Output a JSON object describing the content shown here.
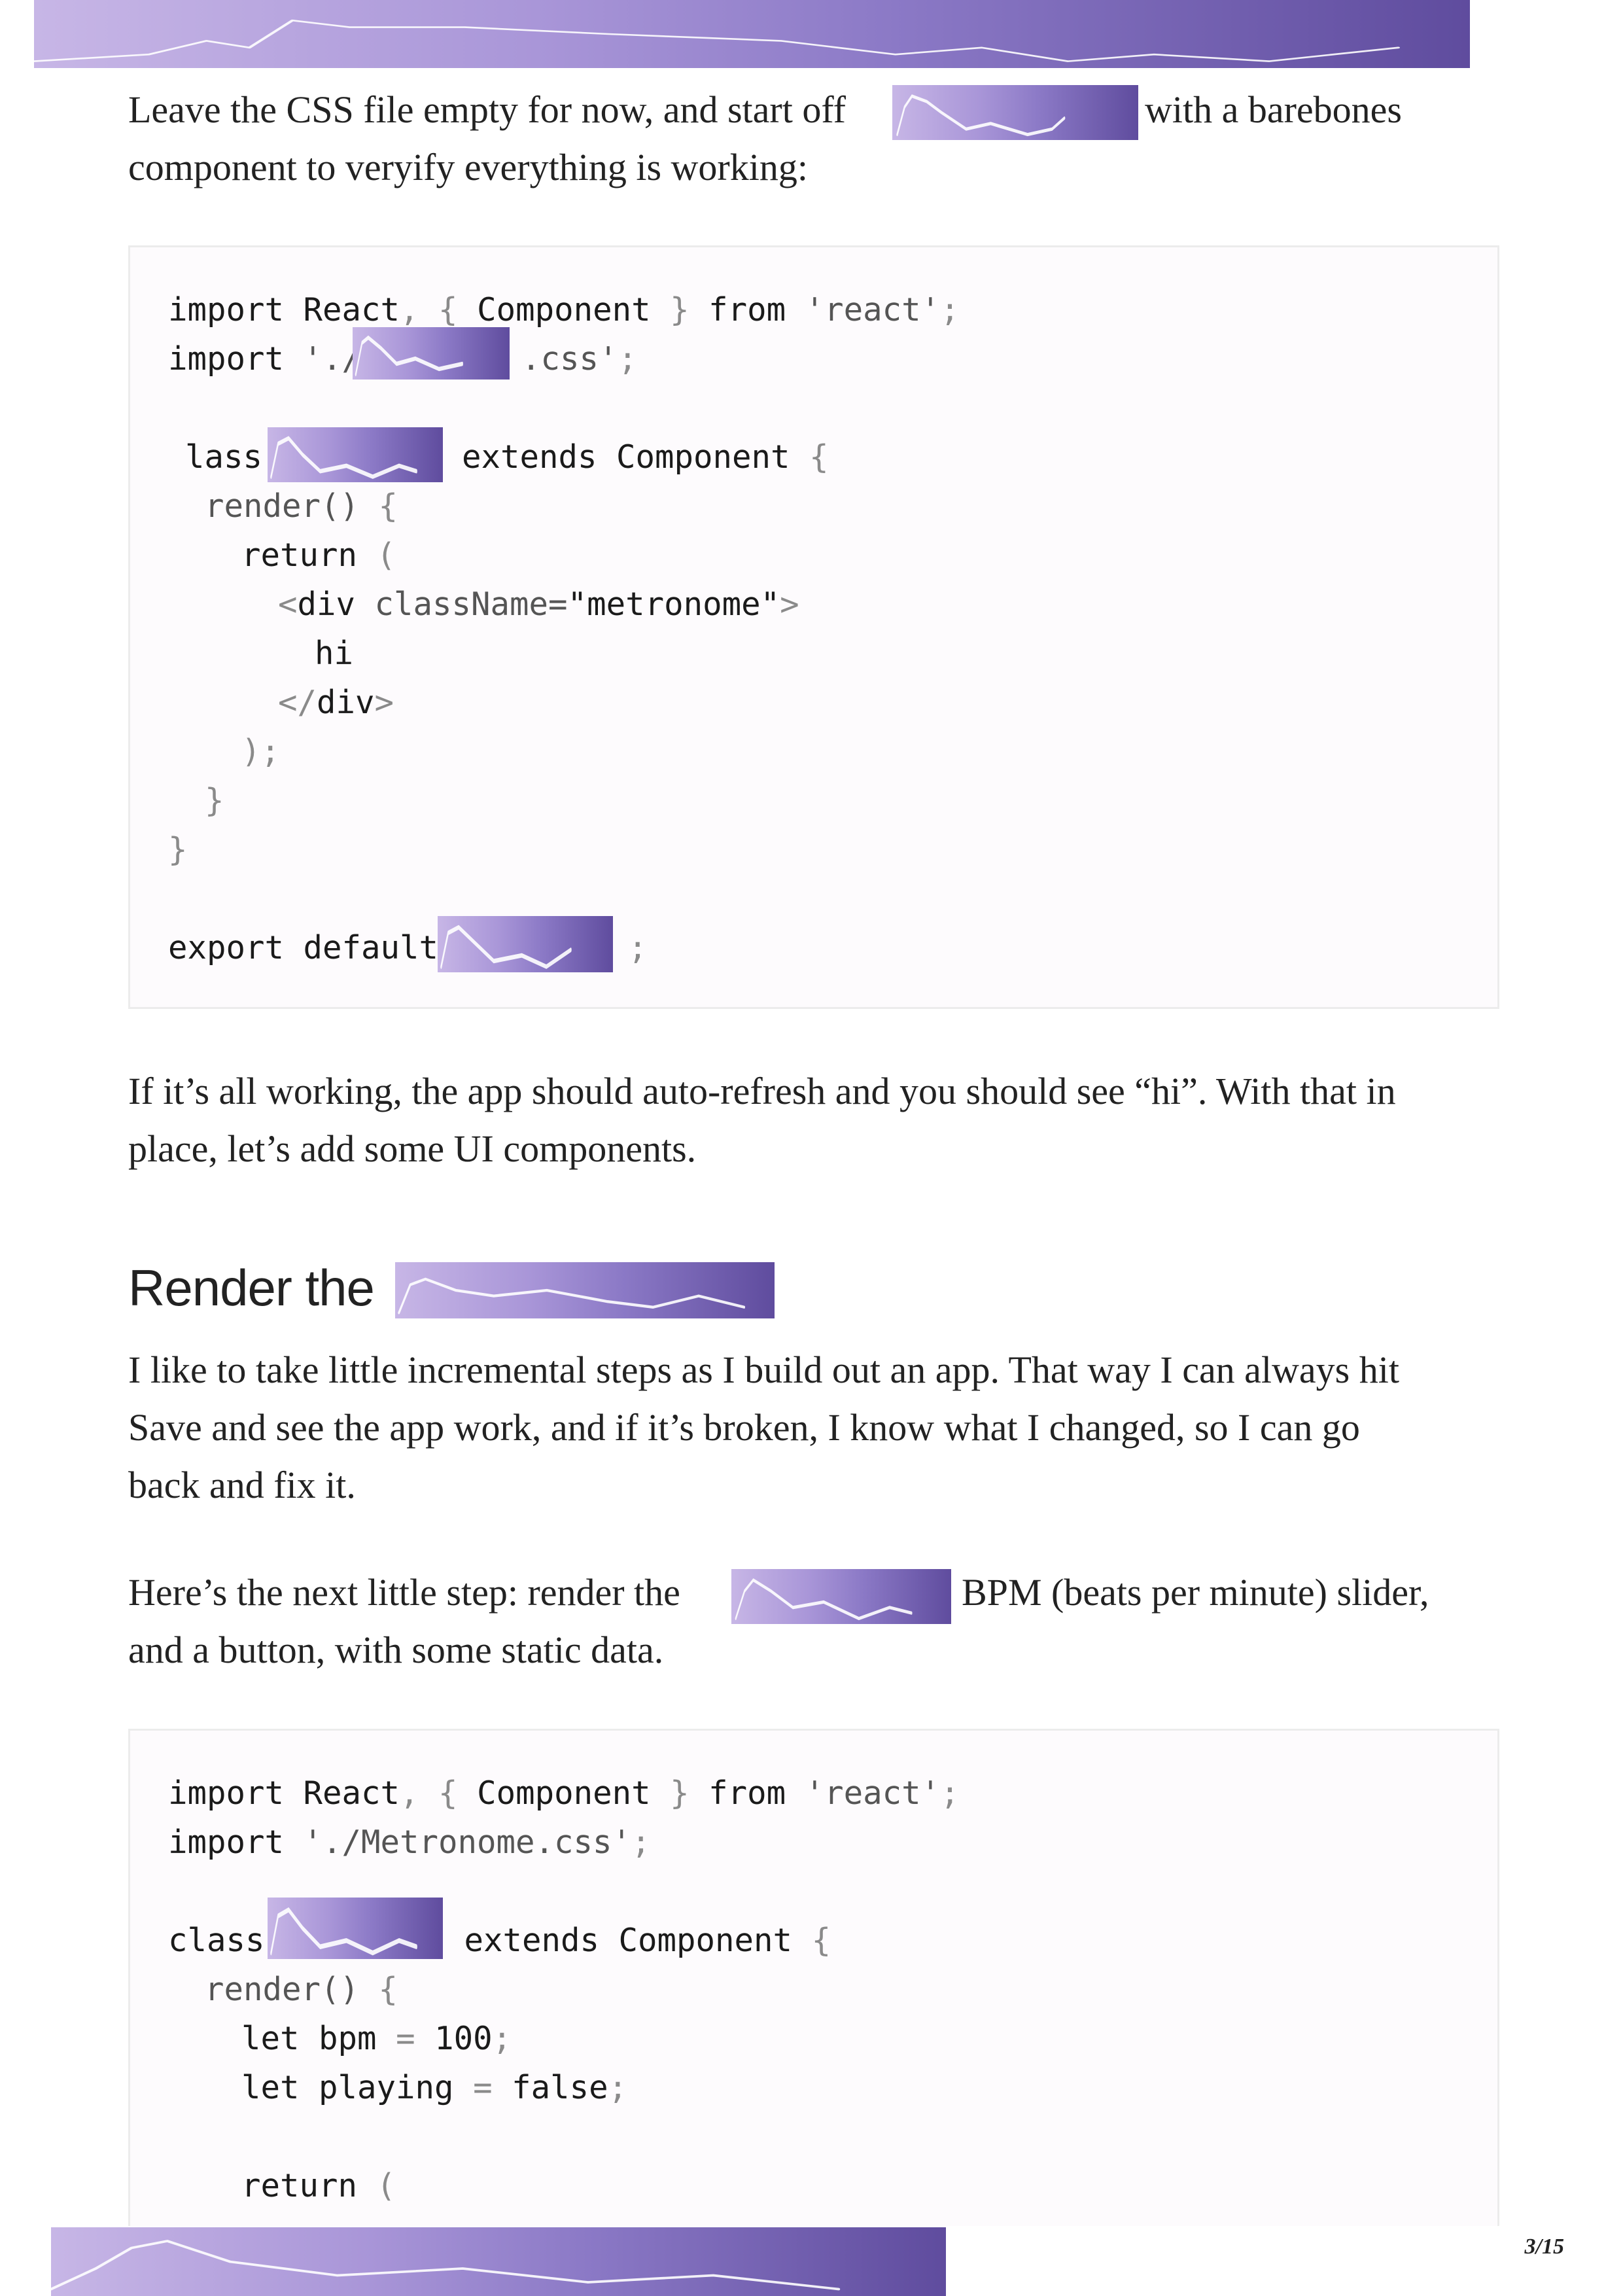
{
  "paragraphs": {
    "p1_before": "Leave the CSS file empty for now, and start off",
    "p1_after": "with a barebones",
    "p1_line2": "component to veryify everything is working:",
    "p2_line1": "If it’s all working, the app should auto-refresh and you should see “hi”. With that in",
    "p2_line2": "place, let’s add some UI components.",
    "p3_line1": "I like to take little incremental steps as I build out an app. That way I can always hit",
    "p3_line2": "Save and see the app work, and if it’s broken, I know what I changed, so I can go",
    "p3_line3": "back and fix it.",
    "p4_before": "Here’s the next little step: render the",
    "p4_after": "BPM (beats per minute) slider,",
    "p4_line2": "and a button, with some static data."
  },
  "heading": {
    "text": "Render the"
  },
  "code1": {
    "l1_import": "import",
    "l1_react": "React",
    "l1_comma_brace": ", {",
    "l1_component": "Component",
    "l1_brace": "}",
    "l1_from": "from",
    "l1_str": "'react'",
    "l1_semi": ";",
    "l2_import": "import",
    "l2_str_start": "'./",
    "l2_str_end": ".css'",
    "l2_semi": ";",
    "l3_class": "lass",
    "l3_extends": "extends",
    "l3_component": "Component",
    "l3_brace": "{",
    "l4_render": "render()",
    "l4_brace": "{",
    "l5_return": "return",
    "l5_paren": "(",
    "l6_open": "<",
    "l6_div": "div",
    "l6_attr": "className=",
    "l6_val": "\"metronome\"",
    "l6_close": ">",
    "l7_text": "hi",
    "l8_open": "</",
    "l8_div": "div",
    "l8_close": ">",
    "l9_text": ");",
    "l10_text": "}",
    "l11_text": "}",
    "l12_export": "export default",
    "l12_semi": ";"
  },
  "code2": {
    "l1_import": "import",
    "l1_react": "React",
    "l1_comma_brace": ", {",
    "l1_component": "Component",
    "l1_brace": "}",
    "l1_from": "from",
    "l1_str": "'react'",
    "l1_semi": ";",
    "l2_import": "import",
    "l2_str": "'./Metronome.css'",
    "l2_semi": ";",
    "l3_class": "class",
    "l3_extends": "extends",
    "l3_component": "Component",
    "l3_brace": "{",
    "l4_render": "render()",
    "l4_brace": "{",
    "l5_let": "let",
    "l5_var": "bpm",
    "l5_eq": "=",
    "l5_val": "100",
    "l5_semi": ";",
    "l6_let": "let",
    "l6_var": "playing",
    "l6_eq": "=",
    "l6_val": "false",
    "l6_semi": ";",
    "l7_return": "return",
    "l7_paren": "("
  },
  "footer": {
    "page_number": "3/15"
  },
  "colors": {
    "redaction_light": "#c7b6e6",
    "redaction_dark": "#5f4c9e",
    "code_bg": "#fdfbfd"
  }
}
